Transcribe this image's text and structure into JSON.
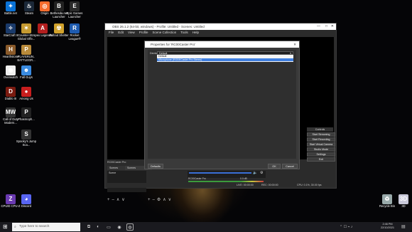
{
  "desktop": {
    "icons": [
      {
        "label": "Battle.net",
        "glyph": "✦",
        "color": "#0a72d6"
      },
      {
        "label": "Steam",
        "glyph": "♨",
        "color": "#1b2838"
      },
      {
        "label": "Origin",
        "glyph": "◎",
        "color": "#f56c2d"
      },
      {
        "label": "Bethesda.net Launcher",
        "glyph": "B",
        "color": "#222"
      },
      {
        "label": "Epic Games Launcher",
        "glyph": "E",
        "color": "#2a2a2a"
      },
      {
        "label": "StarCraft II",
        "glyph": "✧",
        "color": "#1a3a6a"
      },
      {
        "label": "Counter-Str.. Global Offe...",
        "glyph": "✶",
        "color": "#c69a30"
      },
      {
        "label": "Apex Legends",
        "glyph": "A",
        "color": "#b21e1e"
      },
      {
        "label": "Fallout Shelter",
        "glyph": "☢",
        "color": "#d1a22c"
      },
      {
        "label": "Rocket League®",
        "glyph": "R",
        "color": "#1e5bb0"
      },
      {
        "label": "Hearthstone",
        "glyph": "H",
        "color": "#8a5a2a"
      },
      {
        "label": "PLAYERUN.. BATTLEGR...",
        "glyph": "P",
        "color": "#b88a3a"
      },
      {
        "label": "Overwatch",
        "glyph": "◉",
        "color": "#f0f0f0"
      },
      {
        "label": "Fall Guys",
        "glyph": "☻",
        "color": "#3a8be0"
      },
      {
        "label": "Diablo III",
        "glyph": "D",
        "color": "#7a1a10"
      },
      {
        "label": "Among Us",
        "glyph": "●",
        "color": "#c81e1e"
      },
      {
        "label": "Call of Duty Modern...",
        "glyph": "MW",
        "color": "#333"
      },
      {
        "label": "Phasmoph...",
        "glyph": "P",
        "color": "#222"
      },
      {
        "label": "Spooky's Jump Sca...",
        "glyph": "S",
        "color": "#333"
      },
      {
        "label": "CPUID CPU-Z",
        "glyph": "Z",
        "color": "#6a3ab0"
      },
      {
        "label": "Discord",
        "glyph": "◕",
        "color": "#5865f2"
      },
      {
        "label": "Recycle Bin",
        "glyph": "♻",
        "color": "#9aa"
      },
      {
        "label": "3D",
        "glyph": "3D",
        "color": "#c9c9d9"
      }
    ]
  },
  "obs": {
    "title": "OBS 26.1.2 (64-bit, windows) - Profile: Untitled - Scenes: Untitled",
    "menu": [
      "File",
      "Edit",
      "View",
      "Profile",
      "Scene Collection",
      "Tools",
      "Help"
    ],
    "context_label": "RC00Caster Pro",
    "scenes_header": "Scenes",
    "scene_item": "Scene",
    "controls_header": "Controls",
    "controls": [
      "Start Streaming",
      "Start Recording",
      "Start Virtual Camera",
      "Studio Mode",
      "Settings",
      "Exit"
    ],
    "mixer_source": "RC00Caster Pro",
    "mixer_level": "0.0 dB",
    "status": "CPU: 0.1%, 30.00 fps",
    "status_live": "LIVE: 00:00:00",
    "status_rec": "REC: 00:00:00",
    "sources_tab": "Scenes"
  },
  "dialog": {
    "title": "Properties for 'RC00Caster Pro'",
    "device_label": "Device",
    "device_value": "Default",
    "options": [
      "Default",
      "Microphone (RODECaster Pro Stereo)"
    ],
    "defaults_button": "Defaults",
    "ok_button": "OK",
    "cancel_button": "Cancel"
  },
  "taskbar": {
    "search_placeholder": "Type here to search",
    "time": "2:46 PM",
    "date": "22/10/2021"
  }
}
